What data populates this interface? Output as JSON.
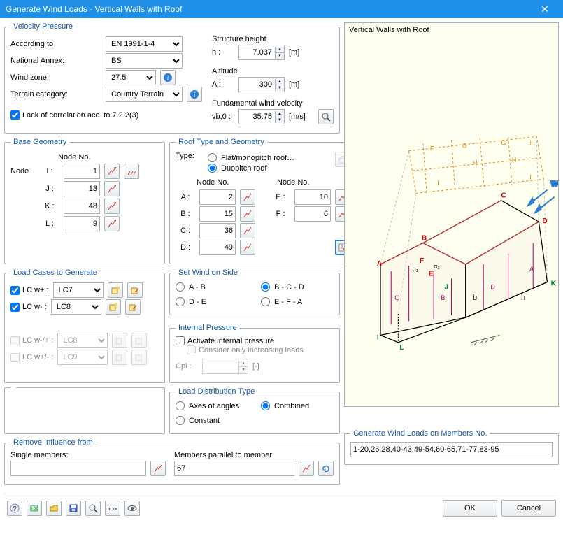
{
  "title": "Generate Wind Loads  -  Vertical Walls with Roof",
  "velocity": {
    "legend": "Velocity Pressure",
    "according_label": "According to",
    "according_value": "EN 1991-1-4",
    "annex_label": "National Annex:",
    "annex_value": "BS",
    "windzone_label": "Wind zone:",
    "windzone_value": "27.5",
    "terrain_label": "Terrain category:",
    "terrain_value": "Country Terrain",
    "lack_label": "Lack of correlation acc. to 7.2.2(3)",
    "struct_height_label": "Structure height",
    "h_label": "h :",
    "h_value": "7.037",
    "h_unit": "[m]",
    "altitude_label": "Altitude",
    "A_label": "A :",
    "A_value": "300",
    "A_unit": "[m]",
    "fundvel_label": "Fundamental wind velocity",
    "vb_label": "vb,0 :",
    "vb_value": "35.75",
    "vb_unit": "[m/s]"
  },
  "basegeo": {
    "legend": "Base Geometry",
    "nodeno": "Node No.",
    "nodelabel": "Node",
    "I_label": "I :",
    "I_value": "1",
    "J_label": "J :",
    "J_value": "13",
    "K_label": "K :",
    "K_value": "48",
    "L_label": "L :",
    "L_value": "9"
  },
  "roof": {
    "legend": "Roof Type and Geometry",
    "type_label": "Type:",
    "flat_label": "Flat/monopitch roof…",
    "duo_label": "Duopitch roof",
    "nodeno": "Node No.",
    "A_l": "A :",
    "A_v": "2",
    "B_l": "B :",
    "B_v": "15",
    "C_l": "C :",
    "C_v": "36",
    "D_l": "D :",
    "D_v": "49",
    "E_l": "E :",
    "E_v": "10",
    "F_l": "F :",
    "F_v": "6"
  },
  "loadcases": {
    "legend": "Load Cases to Generate",
    "wplus": "LC w+ :",
    "wplus_val": "LC7",
    "wminus": "LC w- :",
    "wminus_val": "LC8",
    "wmp": "LC w-/+ :",
    "wmp_val": "LC8",
    "wpm": "LC w+/- :",
    "wpm_val": "LC9"
  },
  "wind_side": {
    "legend": "Set Wind on Side",
    "AB": "A - B",
    "BCD": "B - C - D",
    "DE": "D - E",
    "EFA": "E - F - A"
  },
  "internal": {
    "legend": "Internal Pressure",
    "activate": "Activate internal pressure",
    "consider": "Consider only increasing loads",
    "cpi_label": "Cpi :",
    "cpi_unit": "[-]"
  },
  "distribution": {
    "legend": "Load Distribution Type",
    "axes": "Axes of angles",
    "combined": "Combined",
    "constant": "Constant"
  },
  "remove": {
    "legend": "Remove Influence from",
    "single": "Single members:",
    "parallel": "Members parallel to member:",
    "parallel_value": "67"
  },
  "generate": {
    "legend": "Generate Wind Loads on Members No.",
    "value": "1-20,26,28,40-43,49-54,60-65,71-77,83-95"
  },
  "preview_title": "Vertical Walls with Roof",
  "buttons": {
    "ok": "OK",
    "cancel": "Cancel"
  }
}
